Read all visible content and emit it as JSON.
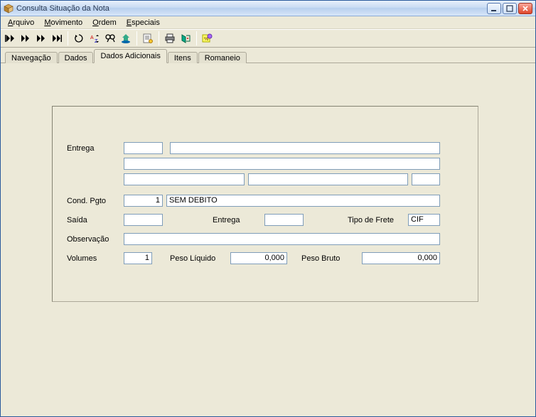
{
  "window": {
    "title": "Consulta Situação da Nota"
  },
  "menu": {
    "items": [
      {
        "label": "Arquivo",
        "ul": "A"
      },
      {
        "label": "Movimento",
        "ul": "M"
      },
      {
        "label": "Ordem",
        "ul": "O"
      },
      {
        "label": "Especiais",
        "ul": "E"
      }
    ]
  },
  "tabs": {
    "items": [
      {
        "label": "Navegação"
      },
      {
        "label": "Dados"
      },
      {
        "label": "Dados Adicionais"
      },
      {
        "label": "Itens"
      },
      {
        "label": "Romaneio"
      }
    ],
    "active_index": 2
  },
  "form": {
    "labels": {
      "entrega": "Entrega",
      "cond_pgto": "Cond. Pgto",
      "saida": "Saída",
      "entrega2": "Entrega",
      "tipo_frete": "Tipo de Frete",
      "observacao": "Observação",
      "volumes": "Volumes",
      "peso_liquido": "Peso Líquido",
      "peso_bruto": "Peso Bruto"
    },
    "values": {
      "entrega_code": "",
      "entrega_desc": "",
      "entrega_line2": "",
      "entrega_sub1": "",
      "entrega_sub2": "",
      "entrega_sub3": "",
      "cond_pgto_code": "1",
      "cond_pgto_desc": "SEM DEBITO",
      "saida": "",
      "entrega2": "",
      "tipo_frete": "CIF",
      "observacao": "",
      "volumes": "1",
      "peso_liquido": "0,000",
      "peso_bruto": "0,000"
    }
  }
}
